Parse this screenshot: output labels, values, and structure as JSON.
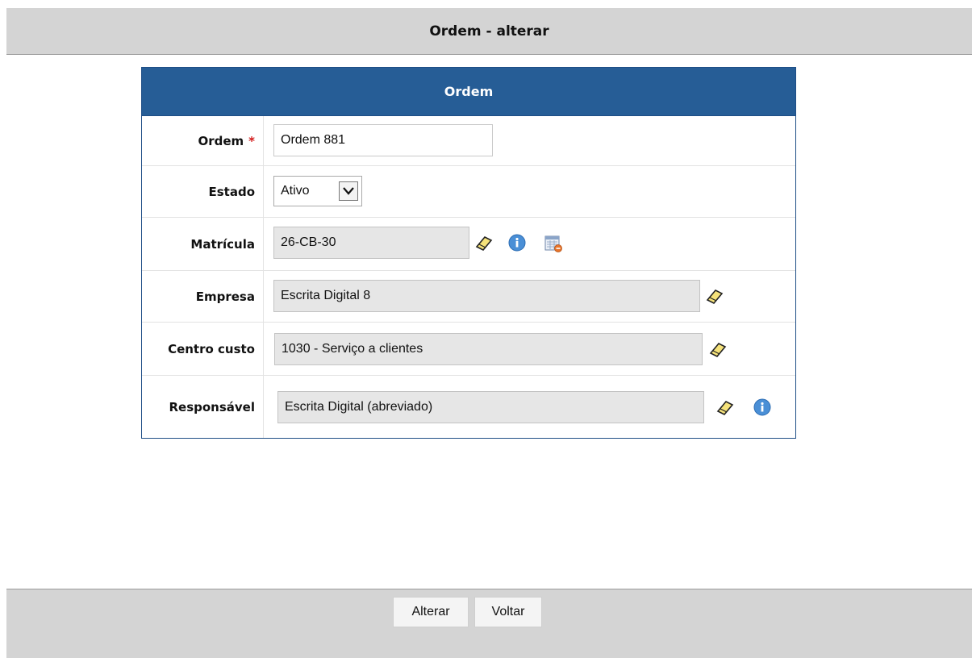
{
  "page": {
    "title": "Ordem - alterar"
  },
  "form": {
    "header": "Ordem",
    "fields": {
      "ordem": {
        "label": "Ordem",
        "required_mark": "*",
        "value": "Ordem 881"
      },
      "estado": {
        "label": "Estado",
        "selected": "Ativo"
      },
      "matricula": {
        "label": "Matrícula",
        "value": "26-CB-30"
      },
      "empresa": {
        "label": "Empresa",
        "value": "Escrita Digital 8"
      },
      "centro_custo": {
        "label": "Centro custo",
        "value": "1030 - Serviço a clientes"
      },
      "responsavel": {
        "label": "Responsável",
        "value": "Escrita Digital (abreviado)"
      }
    }
  },
  "buttons": {
    "alterar": "Alterar",
    "voltar": "Voltar"
  },
  "colors": {
    "panel_header": "#265d96",
    "required": "#d31b1b",
    "bars": "#d4d4d4",
    "info_icon": "#4a8fd6",
    "eraser_icon": "#f5e27a"
  },
  "icons": [
    "eraser-icon",
    "info-icon",
    "calendar-list-icon",
    "chevron-down-icon"
  ]
}
